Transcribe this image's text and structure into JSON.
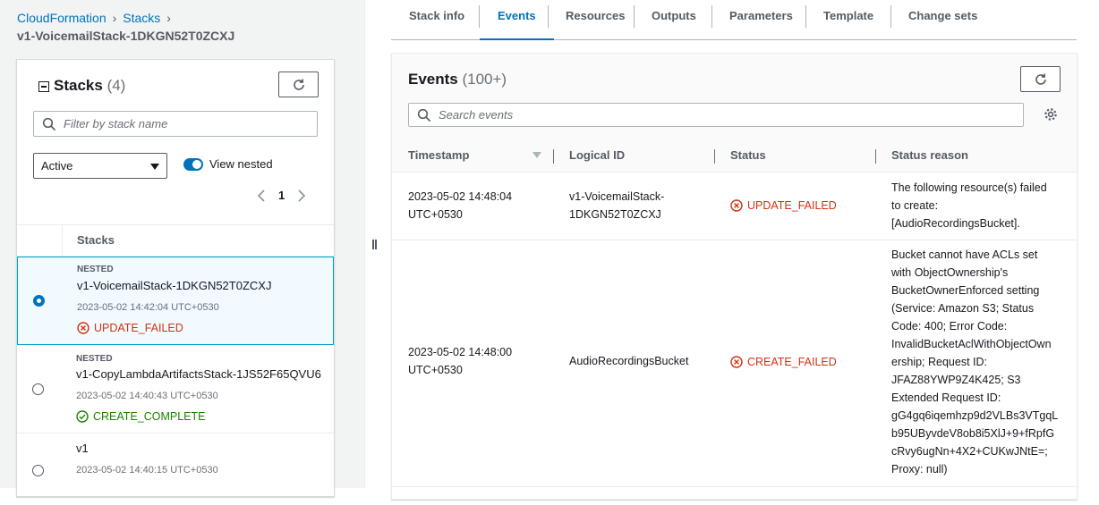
{
  "breadcrumb": {
    "root": "CloudFormation",
    "stacks": "Stacks",
    "current": "v1-VoicemailStack-1DKGN52T0ZCXJ"
  },
  "stacks_panel": {
    "title": "Stacks",
    "count": "(4)",
    "filter_placeholder": "Filter by stack name",
    "filter_select": "Active",
    "view_nested_label": "View nested",
    "page": "1",
    "column_header": "Stacks",
    "rows": [
      {
        "tag": "NESTED",
        "name": "v1-VoicemailStack-1DKGN52T0ZCXJ",
        "date": "2023-05-02 14:42:04 UTC+0530",
        "status": "UPDATE_FAILED"
      },
      {
        "tag": "NESTED",
        "name": "v1-CopyLambdaArtifactsStack-1JS52F65QVU6",
        "date": "2023-05-02 14:40:43 UTC+0530",
        "status": "CREATE_COMPLETE"
      },
      {
        "tag": "",
        "name": "v1",
        "date": "2023-05-02 14:40:15 UTC+0530",
        "status": ""
      }
    ]
  },
  "tabs": [
    "Stack info",
    "Events",
    "Resources",
    "Outputs",
    "Parameters",
    "Template",
    "Change sets"
  ],
  "events_panel": {
    "title": "Events",
    "count": "(100+)",
    "search_placeholder": "Search events",
    "columns": [
      "Timestamp",
      "Logical ID",
      "Status",
      "Status reason"
    ],
    "rows": [
      {
        "timestamp": [
          "2023-05-02 14:48:04",
          "UTC+0530"
        ],
        "logical_id": [
          "v1-VoicemailStack-",
          "1DKGN52T0ZCXJ"
        ],
        "status": "UPDATE_FAILED",
        "reason": [
          "The following resource(s) failed",
          "to create:",
          "[AudioRecordingsBucket]."
        ]
      },
      {
        "timestamp": [
          "2023-05-02 14:48:00",
          "UTC+0530"
        ],
        "logical_id": [
          "AudioRecordingsBucket"
        ],
        "status": "CREATE_FAILED",
        "reason": [
          "Bucket cannot have ACLs set",
          "with ObjectOwnership's",
          "BucketOwnerEnforced setting",
          "(Service: Amazon S3; Status",
          "Code: 400; Error Code:",
          "InvalidBucketAclWithObjectOwn",
          "ership; Request ID:",
          "JFAZ88YWP9Z4K425; S3",
          "Extended Request ID:",
          "gG4gq6iqemhzp9d2VLBs3VTgqL",
          "b95UByvdeV8ob8i5XlJ+9+fRpfG",
          "cRvy6ugNn+4X2+CUKwJNtE=;",
          "Proxy: null)"
        ]
      }
    ]
  }
}
